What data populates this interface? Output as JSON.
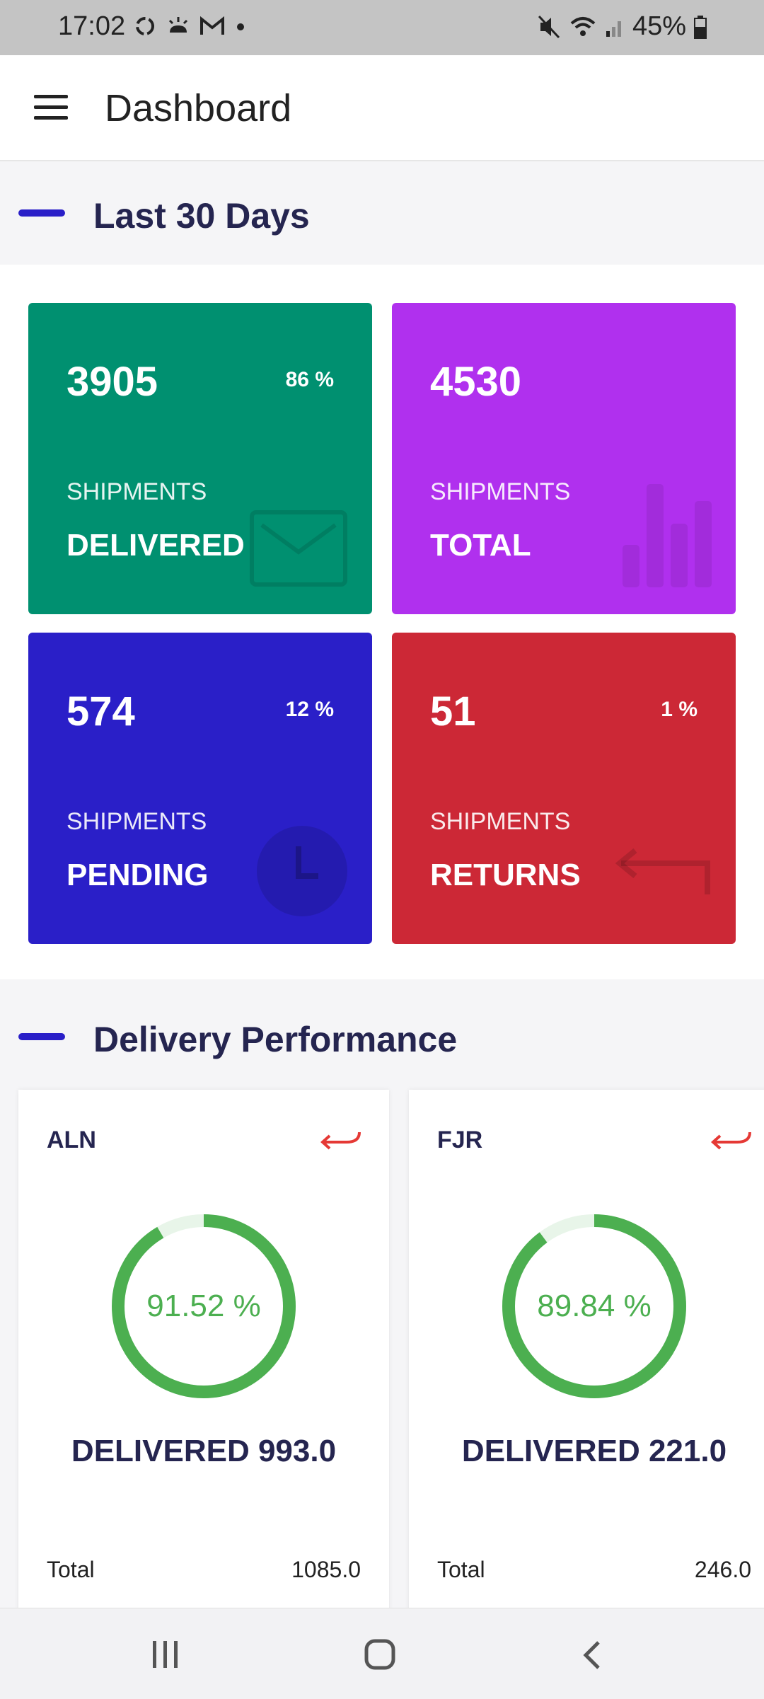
{
  "status_bar": {
    "time": "17:02",
    "battery": "45%",
    "left_icons": [
      "sync-icon",
      "weather-icon",
      "gmail-icon",
      "dot-icon"
    ],
    "right_icons": [
      "mute-icon",
      "wifi-icon",
      "signal-icon",
      "battery-icon"
    ]
  },
  "app_bar": {
    "title": "Dashboard"
  },
  "sections": {
    "last30": "Last 30 Days",
    "performance": "Delivery Performance"
  },
  "tiles": [
    {
      "number": "3905",
      "percent": "86 %",
      "subtitle": "SHIPMENTS",
      "status": "DELIVERED",
      "color": "#009070",
      "icon": "envelope-icon"
    },
    {
      "number": "4530",
      "percent": "",
      "subtitle": "SHIPMENTS",
      "status": "TOTAL",
      "color": "#b030ee",
      "icon": "bar-chart-icon"
    },
    {
      "number": "574",
      "percent": "12 %",
      "subtitle": "SHIPMENTS",
      "status": "PENDING",
      "color": "#2a1fc8",
      "icon": "clock-icon"
    },
    {
      "number": "51",
      "percent": "1 %",
      "subtitle": "SHIPMENTS",
      "status": "RETURNS",
      "color": "#cc2836",
      "icon": "return-arrow-icon"
    }
  ],
  "performance": [
    {
      "code": "ALN",
      "percent_text": "91.52 %",
      "percent": 91.52,
      "delivered": "DELIVERED 993.0",
      "total_label": "Total",
      "total_value": "1085.0"
    },
    {
      "code": "FJR",
      "percent_text": "89.84 %",
      "percent": 89.84,
      "delivered": "DELIVERED 221.0",
      "total_label": "Total",
      "total_value": "246.0"
    }
  ],
  "colors": {
    "ring": "#4caf50",
    "ring_track": "#e8f5e9",
    "heading": "#252550",
    "return_icon": "#e53935"
  }
}
